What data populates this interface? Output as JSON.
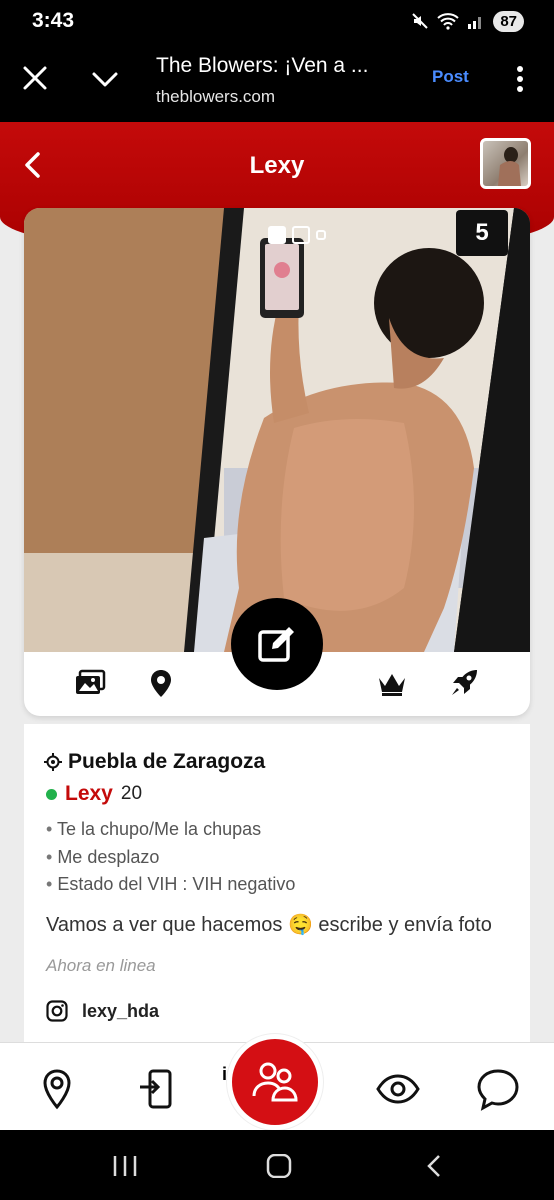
{
  "status_bar": {
    "time": "3:43",
    "battery": "87"
  },
  "browser": {
    "title": "The Blowers: ¡Ven a ...",
    "url": "theblowers.com",
    "post_label": "Post"
  },
  "header": {
    "title": "Lexy"
  },
  "photo": {
    "count": "5",
    "dots": 3
  },
  "profile": {
    "location": "Puebla de Zaragoza",
    "name": "Lexy",
    "age": "20",
    "details": [
      "Te la chupo/Me la chupas",
      "Me desplazo",
      "Estado del VIH : VIH negativo"
    ],
    "about": "Vamos a ver que hacemos 🤤 escribe y envía foto",
    "last_seen": "Ahora en linea",
    "instagram": "lexy_hda"
  },
  "nav": {
    "partial_label": "i"
  },
  "colors": {
    "brand": "#c40a0a",
    "online": "#22b14c"
  }
}
